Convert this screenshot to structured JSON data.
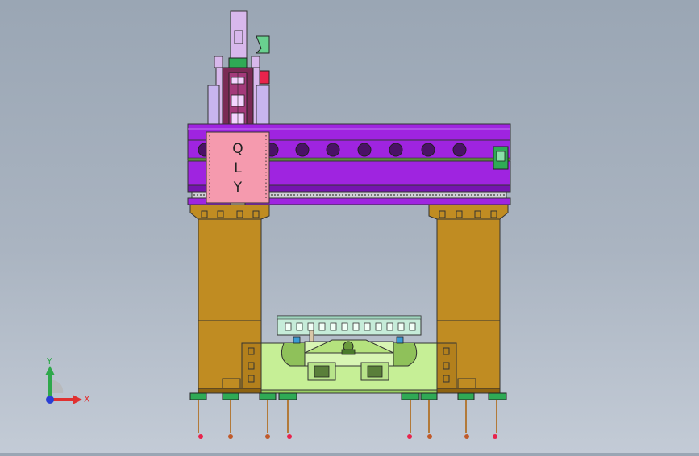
{
  "window": {
    "background_top": "#9aa6b4",
    "background_bottom": "#c3cbd6"
  },
  "model": {
    "carriage_label_letters": [
      "Q",
      "L",
      "Y"
    ],
    "colors": {
      "beam": "#9f24e0",
      "beam_dark": "#7514b0",
      "column": "#c08c22",
      "column_dark": "#8c6210",
      "carriage": "#f59aae",
      "spindle": "#d8b8ec",
      "table": "#c6ef96",
      "fixture": "#c6ecd9",
      "foot": "#2faa55",
      "accent_red": "#e8234c"
    }
  },
  "triad": {
    "y_label": "Y",
    "x_label": "X",
    "y_color": "#2ea84b",
    "x_color": "#e03030",
    "z_color": "#2a3fd4"
  }
}
